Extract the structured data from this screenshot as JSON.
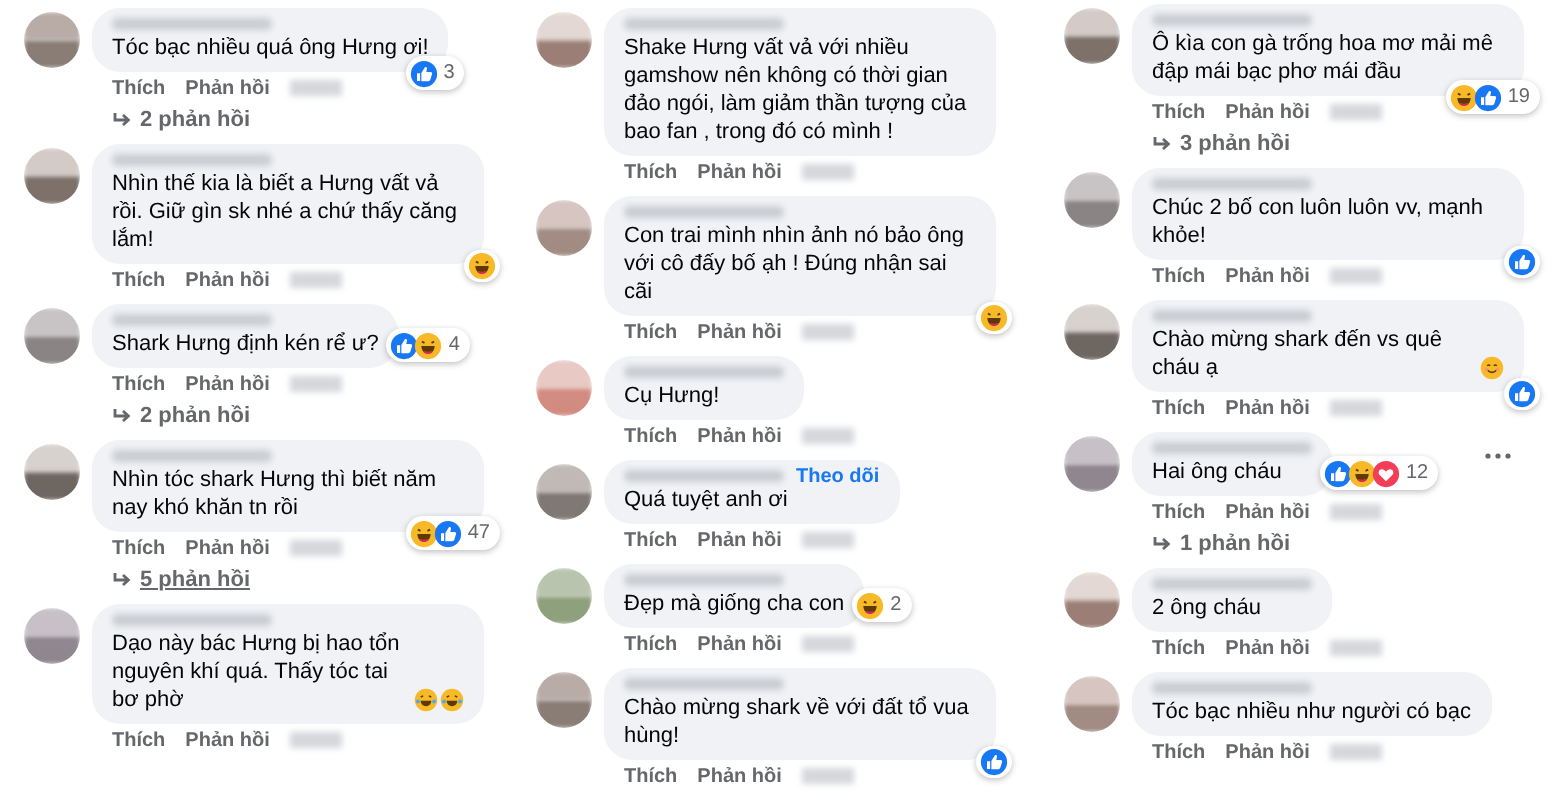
{
  "columns": [
    {
      "comments": [
        {
          "text": "Tóc bạc nhiều quá ông Hưng ơi!",
          "reactions": {
            "icons": [
              {
                "kind": "like"
              }
            ],
            "count": "3"
          },
          "actions": [
            "Thích",
            "Phản hồi"
          ],
          "replies": {
            "label": "2 phản hồi",
            "hovered": false
          }
        },
        {
          "text": "Nhìn thế kia là biết a Hưng vất vả rồi. Giữ gìn sk nhé a chứ thấy căng lắm!",
          "reactions": {
            "icons": [
              {
                "kind": "haha"
              }
            ]
          },
          "actions": [
            "Thích",
            "Phản hồi"
          ]
        },
        {
          "text": "Shark Hưng định kén rể ư?",
          "reactions": {
            "icons": [
              {
                "kind": "like"
              },
              {
                "kind": "haha"
              }
            ],
            "count": "4"
          },
          "actions": [
            "Thích",
            "Phản hồi"
          ],
          "replies": {
            "label": "2 phản hồi",
            "hovered": false
          }
        },
        {
          "text": "Nhìn tóc shark Hưng thì biết năm nay khó khăn tn rồi",
          "reactions": {
            "icons": [
              {
                "kind": "haha"
              },
              {
                "kind": "like"
              }
            ],
            "count": "47"
          },
          "actions": [
            "Thích",
            "Phản hồi"
          ],
          "replies": {
            "label": "5 phản hồi",
            "hovered": true
          }
        },
        {
          "text": "Dạo này bác Hưng bị hao tổn nguyên khí quá. Thấy tóc tai bơ phờ",
          "emojis": [
            {
              "kind": "laugh-cry"
            },
            {
              "kind": "laugh-cry"
            }
          ],
          "actions": [
            "Thích",
            "Phản hồi"
          ]
        }
      ]
    },
    {
      "comments": [
        {
          "text": "Shake Hưng vất vả với nhiều gamshow nên không có thời gian đảo ngói, làm giảm thần tượng của bao fan , trong đó có mình !",
          "actions": [
            "Thích",
            "Phản hồi"
          ]
        },
        {
          "text": "Con trai mình nhìn ảnh nó bảo ông với cô đấy bố ạh ! Đúng nhận sai cãi",
          "reactions": {
            "icons": [
              {
                "kind": "haha"
              }
            ]
          },
          "actions": [
            "Thích",
            "Phản hồi"
          ]
        },
        {
          "text": "Cụ Hưng!",
          "actions": [
            "Thích",
            "Phản hồi"
          ]
        },
        {
          "text": "Quá tuyệt anh ơi",
          "follow": "Theo dõi",
          "actions": [
            "Thích",
            "Phản hồi"
          ]
        },
        {
          "text": "Đẹp mà giống cha con",
          "reactions": {
            "icons": [
              {
                "kind": "haha"
              }
            ],
            "count": "2"
          },
          "actions": [
            "Thích",
            "Phản hồi"
          ]
        },
        {
          "text": "Chào mừng shark về với đất tổ vua hùng!",
          "reactions": {
            "icons": [
              {
                "kind": "like"
              }
            ]
          },
          "actions": [
            "Thích",
            "Phản hồi"
          ]
        }
      ]
    },
    {
      "comments": [
        {
          "text": "Ô kìa con gà trống hoa mơ mải mê đập mái bạc phơ mái đầu",
          "reactions": {
            "icons": [
              {
                "kind": "haha"
              },
              {
                "kind": "like"
              }
            ],
            "count": "19"
          },
          "actions": [
            "Thích",
            "Phản hồi"
          ],
          "replies": {
            "label": "3 phản hồi",
            "hovered": false
          }
        },
        {
          "text": "Chúc 2 bố con luôn luôn vv, mạnh khỏe!",
          "reactions": {
            "icons": [
              {
                "kind": "like"
              }
            ]
          },
          "actions": [
            "Thích",
            "Phản hồi"
          ]
        },
        {
          "text": "Chào mừng shark đến vs quê cháu ạ",
          "emojis": [
            {
              "kind": "smile"
            }
          ],
          "reactions": {
            "icons": [
              {
                "kind": "like"
              }
            ]
          },
          "actions": [
            "Thích",
            "Phản hồi"
          ]
        },
        {
          "text": "Hai ông cháu",
          "reactions": {
            "icons": [
              {
                "kind": "like"
              },
              {
                "kind": "haha"
              },
              {
                "kind": "love"
              }
            ],
            "count": "12"
          },
          "more_menu": true,
          "actions": [
            "Thích",
            "Phản hồi"
          ],
          "replies": {
            "label": "1 phản hồi",
            "hovered": false
          }
        },
        {
          "text": "2 ông cháu",
          "actions": [
            "Thích",
            "Phản hồi"
          ]
        },
        {
          "text": "Tóc bạc nhiều như người có bạc",
          "actions": [
            "Thích",
            "Phản hồi"
          ]
        }
      ]
    }
  ]
}
